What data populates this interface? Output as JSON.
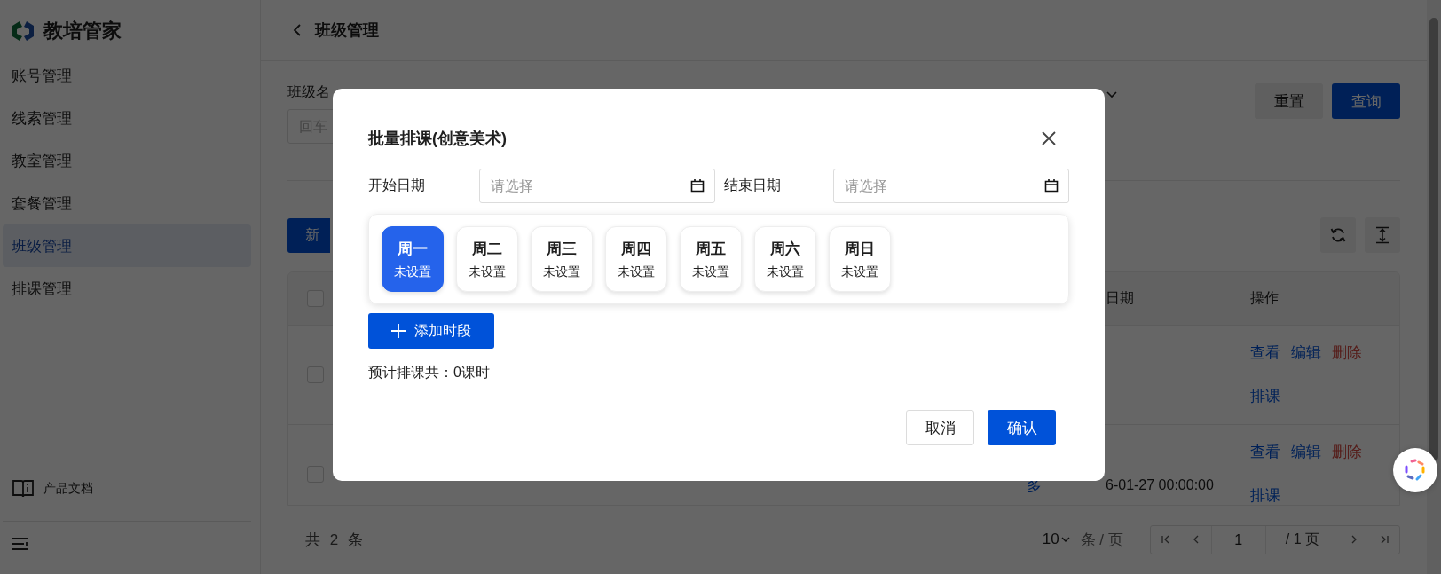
{
  "sidebar": {
    "logo": "教培管家",
    "items": [
      {
        "label": "账号管理",
        "selected": false
      },
      {
        "label": "线索管理",
        "selected": false
      },
      {
        "label": "教室管理",
        "selected": false
      },
      {
        "label": "套餐管理",
        "selected": false
      },
      {
        "label": "班级管理",
        "selected": true
      },
      {
        "label": "排课管理",
        "selected": false
      }
    ],
    "docs": "产品文档"
  },
  "header": {
    "title": "班级管理"
  },
  "filters": {
    "label": "班级名",
    "placeholder": "回车",
    "reset": "重置",
    "query": "查询"
  },
  "toolbar": {
    "new_button": "新"
  },
  "table": {
    "all_checked": false,
    "columns": [
      {
        "label": "日期"
      },
      {
        "label": "操作"
      }
    ],
    "rows": [
      {
        "checked": false,
        "actions": [
          {
            "label": "查看",
            "kind": "link"
          },
          {
            "label": "编辑",
            "kind": "link"
          },
          {
            "label": "删除",
            "kind": "danger"
          },
          {
            "label": "排课",
            "kind": "link"
          }
        ]
      },
      {
        "checked": false,
        "more": "多",
        "date": "6-01-27 00:00:00",
        "actions": [
          {
            "label": "查看",
            "kind": "link"
          },
          {
            "label": "编辑",
            "kind": "link"
          },
          {
            "label": "删除",
            "kind": "danger"
          },
          {
            "label": "排课",
            "kind": "link"
          }
        ]
      }
    ]
  },
  "footer": {
    "total": "共 2 条",
    "page_size": "10",
    "per_page": "条 / 页",
    "page": "1",
    "page_count": "/ 1 页"
  },
  "dialog": {
    "title": "批量排课(创意美术)",
    "start_label": "开始日期",
    "start_placeholder": "请选择",
    "end_label": "结束日期",
    "end_placeholder": "请选择",
    "days": [
      {
        "name": "周一",
        "status": "未设置",
        "selected": true
      },
      {
        "name": "周二",
        "status": "未设置",
        "selected": false
      },
      {
        "name": "周三",
        "status": "未设置",
        "selected": false
      },
      {
        "name": "周四",
        "status": "未设置",
        "selected": false
      },
      {
        "name": "周五",
        "status": "未设置",
        "selected": false
      },
      {
        "name": "周六",
        "status": "未设置",
        "selected": false
      },
      {
        "name": "周日",
        "status": "未设置",
        "selected": false
      }
    ],
    "add_button": "添加时段",
    "estimate": "预计排课共：0课时",
    "cancel": "取消",
    "confirm": "确认"
  }
}
